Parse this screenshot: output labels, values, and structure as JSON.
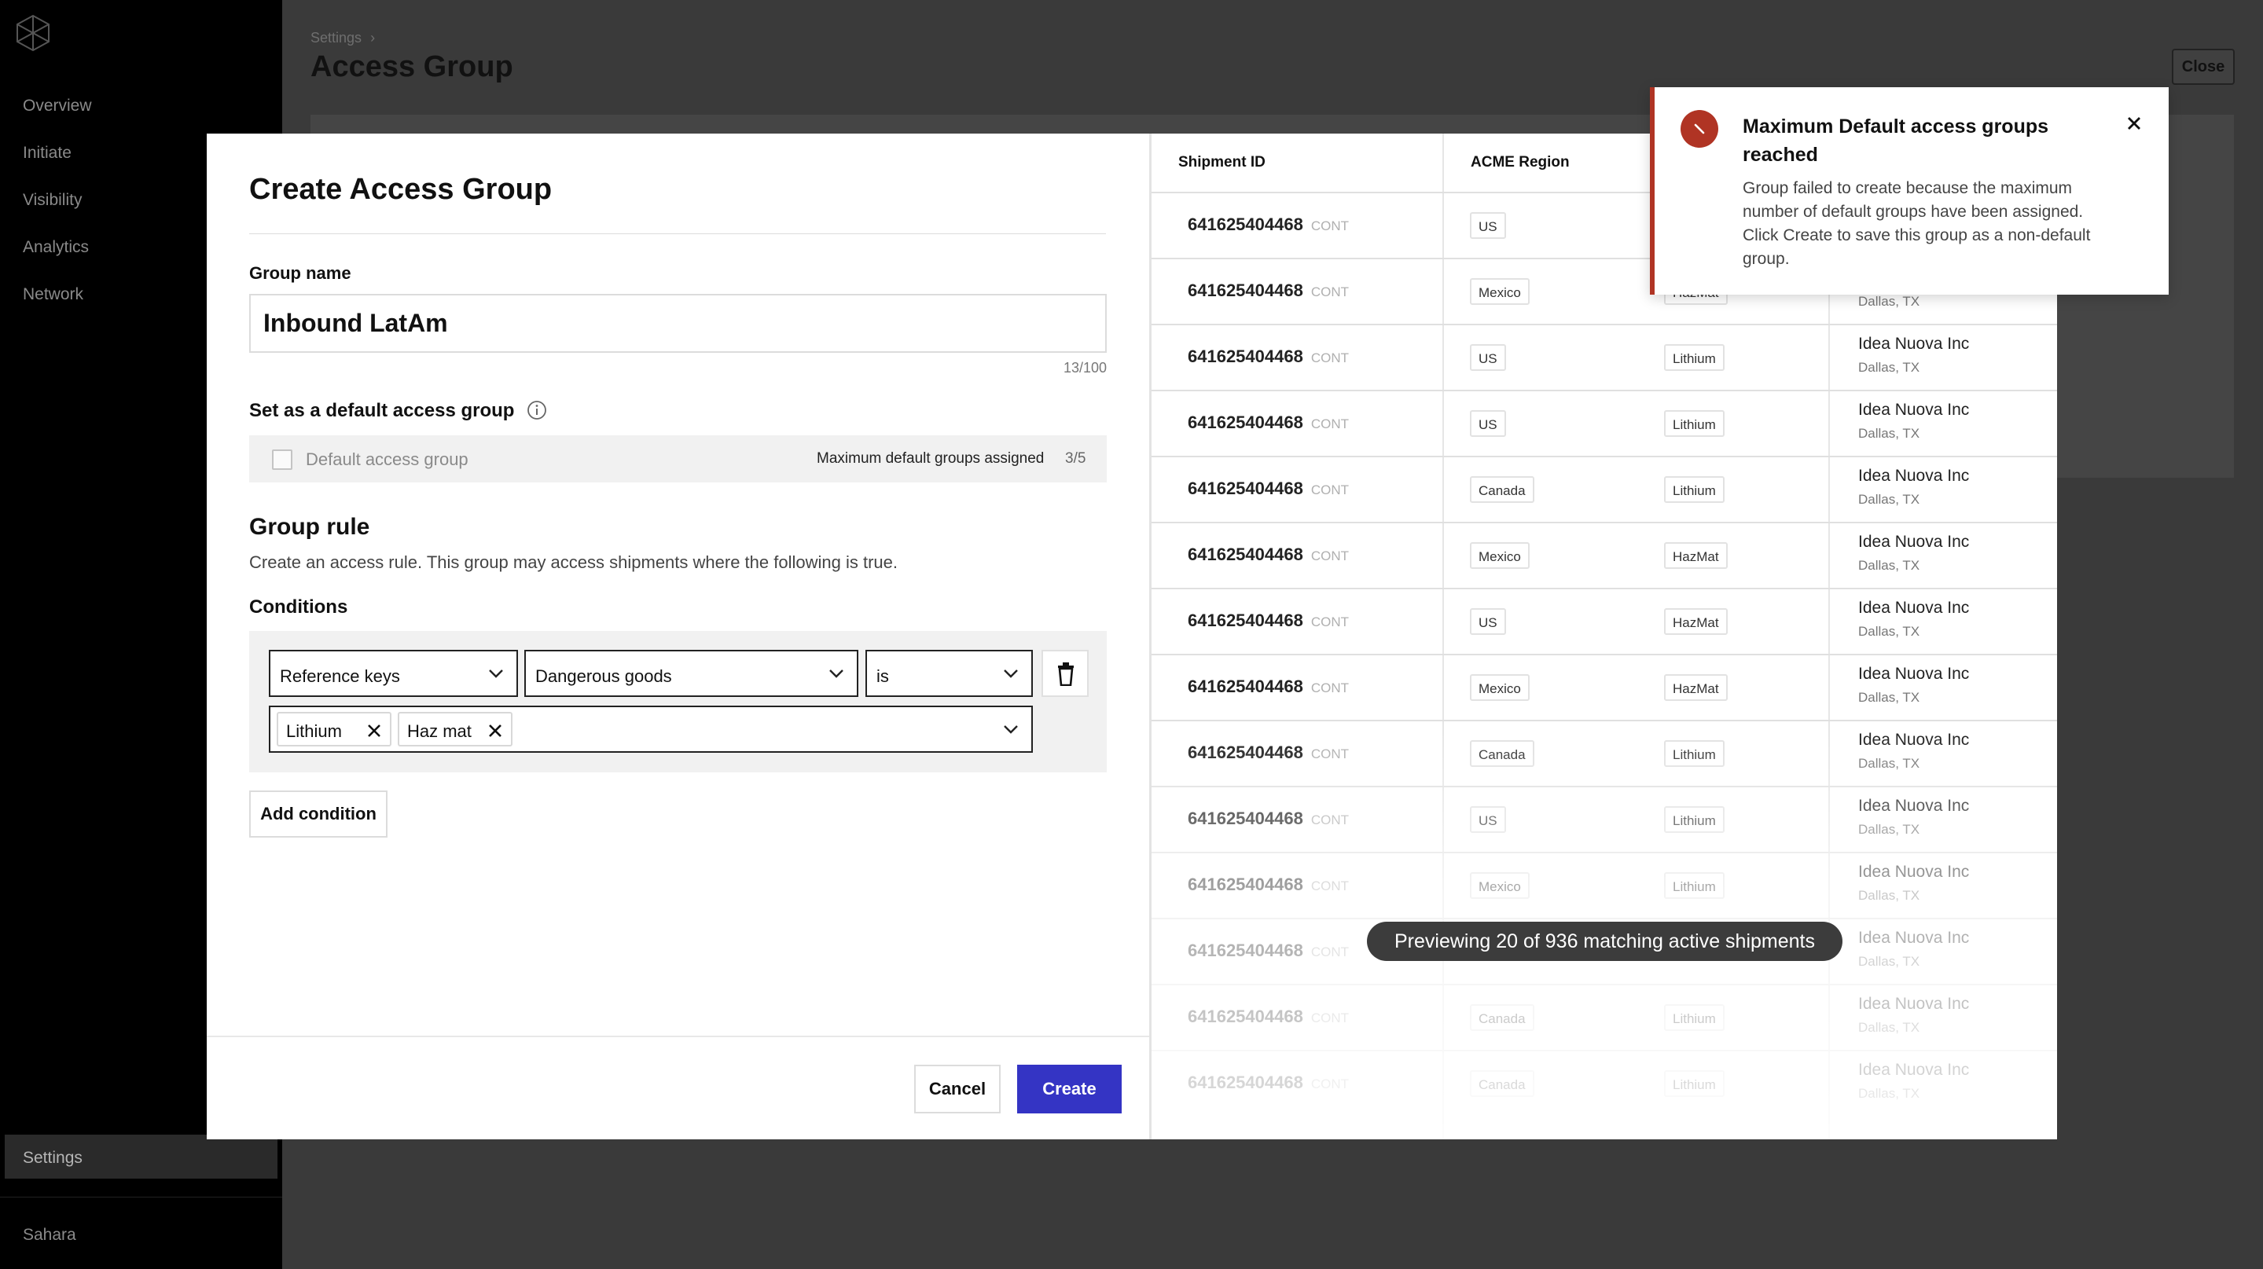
{
  "sidebar": {
    "items": [
      "Overview",
      "Initiate",
      "Visibility",
      "Analytics",
      "Network"
    ],
    "active_item": "Settings",
    "workspace": "Sahara"
  },
  "page": {
    "breadcrumb": "Settings",
    "breadcrumb_separator": "›",
    "title": "Access Group",
    "close_label": "Close"
  },
  "modal": {
    "title": "Create Access Group",
    "group_name_label": "Group name",
    "group_name_value": "Inbound LatAm",
    "group_name_count": "13/100",
    "default_heading": "Set as a default access group",
    "default_checkbox_label": "Default access group",
    "default_max_text": "Maximum default groups assigned",
    "default_max_count": "3/5",
    "group_rule_heading": "Group rule",
    "group_rule_desc": "Create an access rule. This group may access shipments where the following is true.",
    "conditions_label": "Conditions",
    "condition": {
      "field": "Reference keys",
      "key": "Dangerous goods",
      "operator": "is",
      "values": [
        "Lithium",
        "Haz mat"
      ]
    },
    "add_condition_label": "Add condition",
    "cancel_label": "Cancel",
    "create_label": "Create"
  },
  "preview": {
    "headers": [
      "Shipment ID",
      "ACME Region"
    ],
    "rows": [
      {
        "id": "641625404468",
        "type": "CONT",
        "region": "US",
        "goods": "",
        "company": "",
        "city": ""
      },
      {
        "id": "641625404468",
        "type": "CONT",
        "region": "Mexico",
        "goods": "HazMat",
        "company": "",
        "city": "Dallas, TX"
      },
      {
        "id": "641625404468",
        "type": "CONT",
        "region": "US",
        "goods": "Lithium",
        "company": "Idea Nuova Inc",
        "city": "Dallas, TX"
      },
      {
        "id": "641625404468",
        "type": "CONT",
        "region": "US",
        "goods": "Lithium",
        "company": "Idea Nuova Inc",
        "city": "Dallas, TX"
      },
      {
        "id": "641625404468",
        "type": "CONT",
        "region": "Canada",
        "goods": "Lithium",
        "company": "Idea Nuova Inc",
        "city": "Dallas, TX"
      },
      {
        "id": "641625404468",
        "type": "CONT",
        "region": "Mexico",
        "goods": "HazMat",
        "company": "Idea Nuova Inc",
        "city": "Dallas, TX"
      },
      {
        "id": "641625404468",
        "type": "CONT",
        "region": "US",
        "goods": "HazMat",
        "company": "Idea Nuova Inc",
        "city": "Dallas, TX"
      },
      {
        "id": "641625404468",
        "type": "CONT",
        "region": "Mexico",
        "goods": "HazMat",
        "company": "Idea Nuova Inc",
        "city": "Dallas, TX"
      },
      {
        "id": "641625404468",
        "type": "CONT",
        "region": "Canada",
        "goods": "Lithium",
        "company": "Idea Nuova Inc",
        "city": "Dallas, TX"
      },
      {
        "id": "641625404468",
        "type": "CONT",
        "region": "US",
        "goods": "Lithium",
        "company": "Idea Nuova Inc",
        "city": "Dallas, TX"
      },
      {
        "id": "641625404468",
        "type": "CONT",
        "region": "Mexico",
        "goods": "Lithium",
        "company": "Idea Nuova Inc",
        "city": "Dallas, TX"
      },
      {
        "id": "641625404468",
        "type": "CONT",
        "region": "",
        "goods": "",
        "company": "Idea Nuova Inc",
        "city": "Dallas, TX"
      },
      {
        "id": "641625404468",
        "type": "CONT",
        "region": "Canada",
        "goods": "Lithium",
        "company": "Idea Nuova Inc",
        "city": "Dallas, TX"
      },
      {
        "id": "641625404468",
        "type": "CONT",
        "region": "Canada",
        "goods": "Lithium",
        "company": "Idea Nuova Inc",
        "city": "Dallas, TX"
      }
    ],
    "status_pill": "Previewing 20 of 936 matching active shipments"
  },
  "toast": {
    "title": "Maximum Default access groups reached",
    "message": "Group failed to create because the maximum number of default groups have been assigned. Click Create to save this group as a non-default group.",
    "icon": "error-icon",
    "accent_color": "#b03424"
  },
  "colors": {
    "primary": "#3434c4",
    "error": "#b03424"
  }
}
